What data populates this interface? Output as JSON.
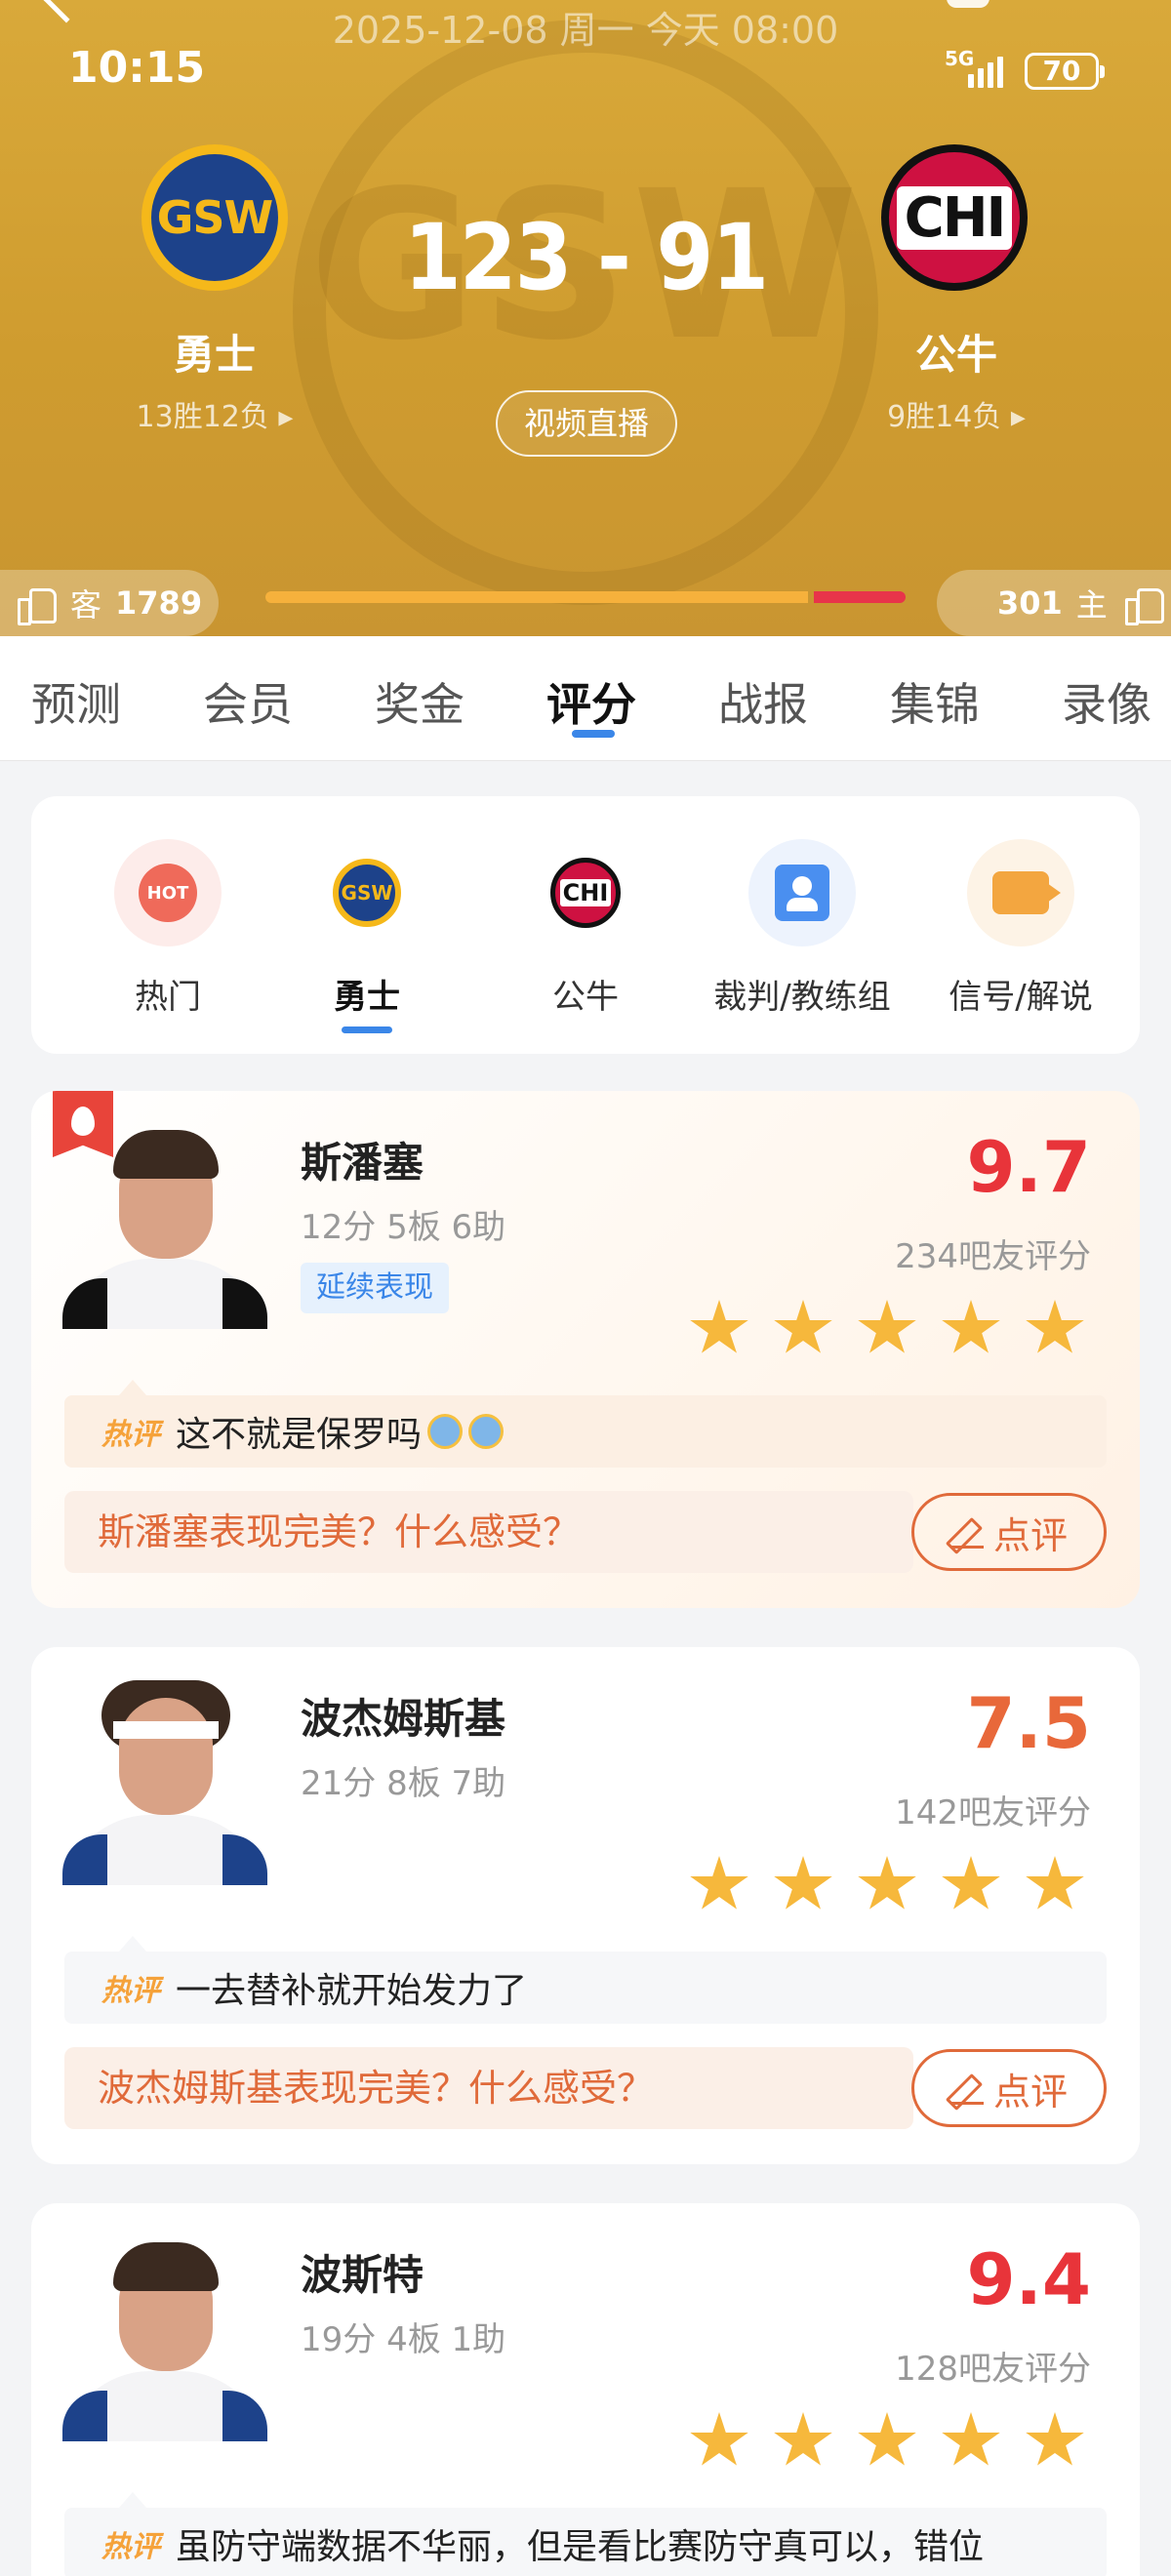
{
  "status_bar": {
    "time": "10:15",
    "network": "5G",
    "battery": "70"
  },
  "game": {
    "date_line": "2025-12-08 周一 今天 08:00",
    "score": "123 - 91",
    "video_button": "视频直播",
    "home_team": {
      "logo_text": "GSW",
      "name": "勇士",
      "record": "13胜12负"
    },
    "away_team": {
      "logo_text": "CHI",
      "name": "公牛",
      "record": "9胜14负"
    },
    "watermark": "GSW"
  },
  "votes": {
    "left_label": "客",
    "left_count": "1789",
    "right_label": "主",
    "right_count": "301",
    "left_share": 0.856,
    "colors": {
      "left": "#f6b13c",
      "right": "#e8344a"
    }
  },
  "tabs": [
    {
      "label": "预测"
    },
    {
      "label": "会员"
    },
    {
      "label": "奖金"
    },
    {
      "label": "评分",
      "active": true
    },
    {
      "label": "战报"
    },
    {
      "label": "集锦"
    },
    {
      "label": "录像"
    }
  ],
  "categories": [
    {
      "label": "热门",
      "icon": "hot-icon",
      "icon_text": "HOT"
    },
    {
      "label": "勇士",
      "icon": "gsw-logo-icon",
      "icon_text": "GSW",
      "active": true
    },
    {
      "label": "公牛",
      "icon": "chi-logo-icon",
      "icon_text": "CHI"
    },
    {
      "label": "裁判/教练组",
      "icon": "referee-icon"
    },
    {
      "label": "信号/解说",
      "icon": "camera-icon"
    }
  ],
  "players": [
    {
      "name": "斯潘塞",
      "stats": "12分 5板 6助",
      "tag": "延续表现",
      "score": "9.7",
      "votes": "234吧友评分",
      "stars": 5,
      "hot_badge": "热评",
      "hot_comment": "这不就是保罗吗",
      "ask": "斯潘塞表现完美？什么感受？",
      "review_button": "点评"
    },
    {
      "name": "波杰姆斯基",
      "stats": "21分 8板 7助",
      "score": "7.5",
      "votes": "142吧友评分",
      "stars": 5,
      "hot_badge": "热评",
      "hot_comment": "一去替补就开始发力了",
      "ask": "波杰姆斯基表现完美？什么感受？",
      "review_button": "点评"
    },
    {
      "name": "波斯特",
      "stats": "19分 4板 1助",
      "score": "9.4",
      "votes": "128吧友评分",
      "stars": 5,
      "hot_badge": "热评",
      "hot_comment": "虽防守端数据不华丽，但是看比赛防守真可以，错位"
    }
  ]
}
